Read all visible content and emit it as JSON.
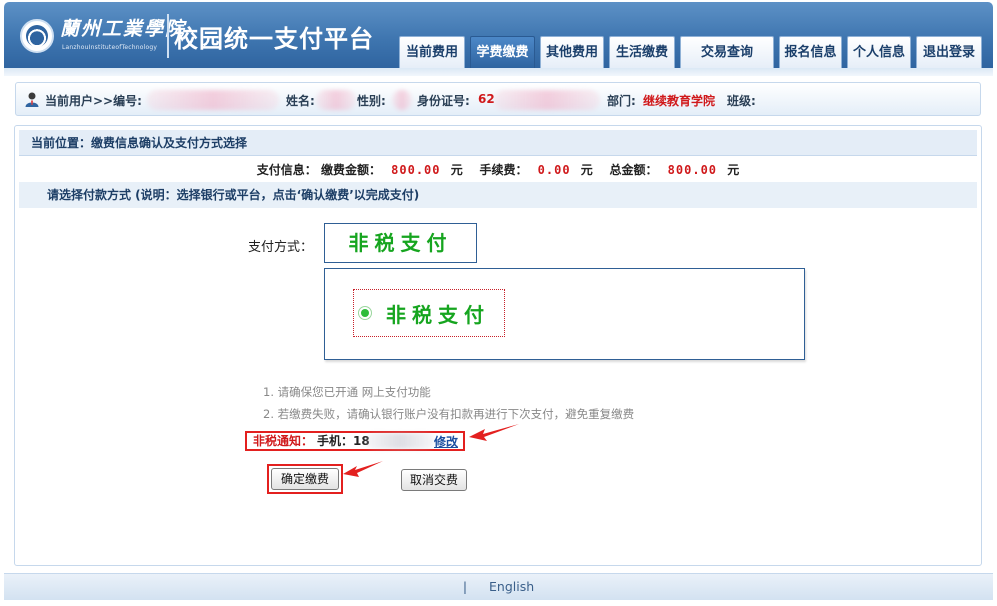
{
  "header": {
    "school_name": "蘭州工業學院",
    "school_name_en": "LanzhouInstituteofTechnology",
    "platform_title": "校园统一支付平台"
  },
  "nav": {
    "tabs": [
      {
        "label": "当前费用",
        "active": false
      },
      {
        "label": "学费缴费",
        "active": true
      },
      {
        "label": "其他费用",
        "active": false
      },
      {
        "label": "生活缴费",
        "active": false
      },
      {
        "label": "交易查询",
        "active": false
      },
      {
        "label": "报名信息",
        "active": false
      },
      {
        "label": "个人信息",
        "active": false
      },
      {
        "label": "退出登录",
        "active": false
      }
    ]
  },
  "userbar": {
    "current_user_label": "当前用户>>编号:",
    "name_label": "姓名:",
    "gender_label": "性别:",
    "id_label": "身份证号:",
    "id_value": "62",
    "dept_label": "部门:",
    "dept_value": "继续教育学院",
    "class_label": "班级:"
  },
  "main": {
    "location": "当前位置：缴费信息确认及支付方式选择",
    "payinfo": {
      "label": "支付信息：",
      "amount_label": "缴费金额：",
      "amount": "800.00",
      "fee_label": "手续费：",
      "fee": "0.00",
      "total_label": "总金额：",
      "total": "800.00",
      "unit": "元"
    },
    "choose_text": "请选择付款方式 (说明：选择银行或平台，点击‘确认缴费’以完成支付)",
    "paymethod_label": "支付方式：",
    "paymethod_selected": "非税支付",
    "option_label": "非税支付",
    "notes": [
      "1. 请确保您已开通 网上支付功能",
      "2. 若缴费失败，请确认银行账户没有扣款再进行下次支付，避免重复缴费"
    ],
    "notice": {
      "label": "非税通知：",
      "phone_label": "手机：",
      "phone_prefix": "18",
      "modify": "修改"
    },
    "confirm_button": "确定缴费",
    "cancel_button": "取消交费"
  },
  "footer": {
    "separator": "|",
    "lang_link": "English"
  },
  "colors": {
    "header_blue": "#3f76b0",
    "accent_red": "#d0191b",
    "pay_green": "#16a51f"
  }
}
